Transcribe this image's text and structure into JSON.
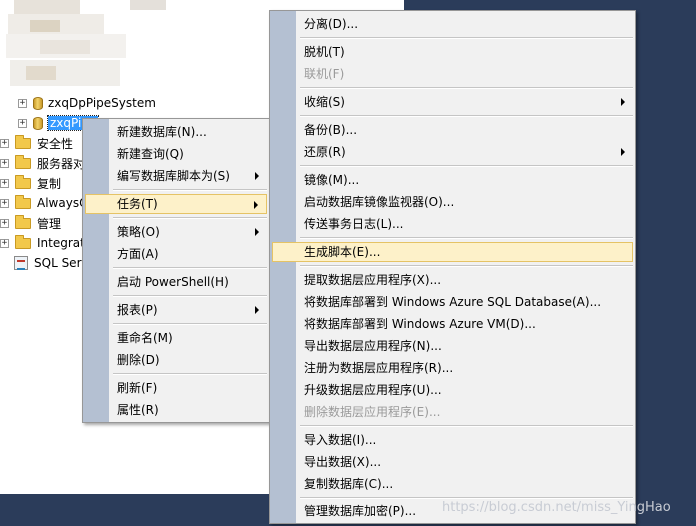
{
  "tree": {
    "items": [
      {
        "label": "zxqDpPipeSystem",
        "icon": "database-icon",
        "expander": "+"
      },
      {
        "label": "zxqPipe",
        "icon": "database-icon",
        "expander": "+",
        "selected": true
      },
      {
        "label": "安全性",
        "icon": "folder-icon",
        "expander": "+"
      },
      {
        "label": "服务器对",
        "icon": "folder-icon",
        "expander": "+"
      },
      {
        "label": "复制",
        "icon": "folder-icon",
        "expander": "+"
      },
      {
        "label": "AlwaysO",
        "icon": "folder-icon",
        "expander": "+"
      },
      {
        "label": "管理",
        "icon": "folder-icon",
        "expander": "+"
      },
      {
        "label": "Integrat",
        "icon": "folder-icon",
        "expander": "+"
      },
      {
        "label": "SQL Ser",
        "icon": "sql-agent-icon",
        "expander": ""
      }
    ]
  },
  "context_menu": {
    "items": [
      {
        "label": "新建数据库(N)..."
      },
      {
        "label": "新建查询(Q)"
      },
      {
        "label": "编写数据库脚本为(S)",
        "submenu": true
      },
      {
        "label": "任务(T)",
        "submenu": true,
        "highlighted": true
      },
      {
        "label": "策略(O)",
        "submenu": true
      },
      {
        "label": "方面(A)"
      },
      {
        "label": "启动 PowerShell(H)"
      },
      {
        "label": "报表(P)",
        "submenu": true
      },
      {
        "label": "重命名(M)"
      },
      {
        "label": "删除(D)"
      },
      {
        "label": "刷新(F)"
      },
      {
        "label": "属性(R)"
      }
    ]
  },
  "tasks_menu": {
    "items": [
      {
        "label": "分离(D)..."
      },
      {
        "label": "脱机(T)"
      },
      {
        "label": "联机(F)",
        "disabled": true
      },
      {
        "label": "收缩(S)",
        "submenu": true
      },
      {
        "label": "备份(B)..."
      },
      {
        "label": "还原(R)",
        "submenu": true
      },
      {
        "label": "镜像(M)..."
      },
      {
        "label": "启动数据库镜像监视器(O)..."
      },
      {
        "label": "传送事务日志(L)..."
      },
      {
        "label": "生成脚本(E)...",
        "highlighted": true
      },
      {
        "label": "提取数据层应用程序(X)..."
      },
      {
        "label": "将数据库部署到 Windows Azure SQL Database(A)..."
      },
      {
        "label": "将数据库部署到 Windows Azure VM(D)..."
      },
      {
        "label": "导出数据层应用程序(N)..."
      },
      {
        "label": "注册为数据层应用程序(R)..."
      },
      {
        "label": "升级数据层应用程序(U)..."
      },
      {
        "label": "删除数据层应用程序(E)...",
        "disabled": true
      },
      {
        "label": "导入数据(I)..."
      },
      {
        "label": "导出数据(X)..."
      },
      {
        "label": "复制数据库(C)..."
      },
      {
        "label": "管理数据库加密(P)..."
      }
    ]
  },
  "watermark": "https://blog.csdn.net/miss_YingHao",
  "colors": {
    "background_dark": "#2b3c5a",
    "menu_background": "#f1f1f1",
    "menu_gutter": "#b4c0d2",
    "highlight": "#fdf1c9",
    "highlight_border": "#e5c365",
    "selection": "#3399ff"
  }
}
